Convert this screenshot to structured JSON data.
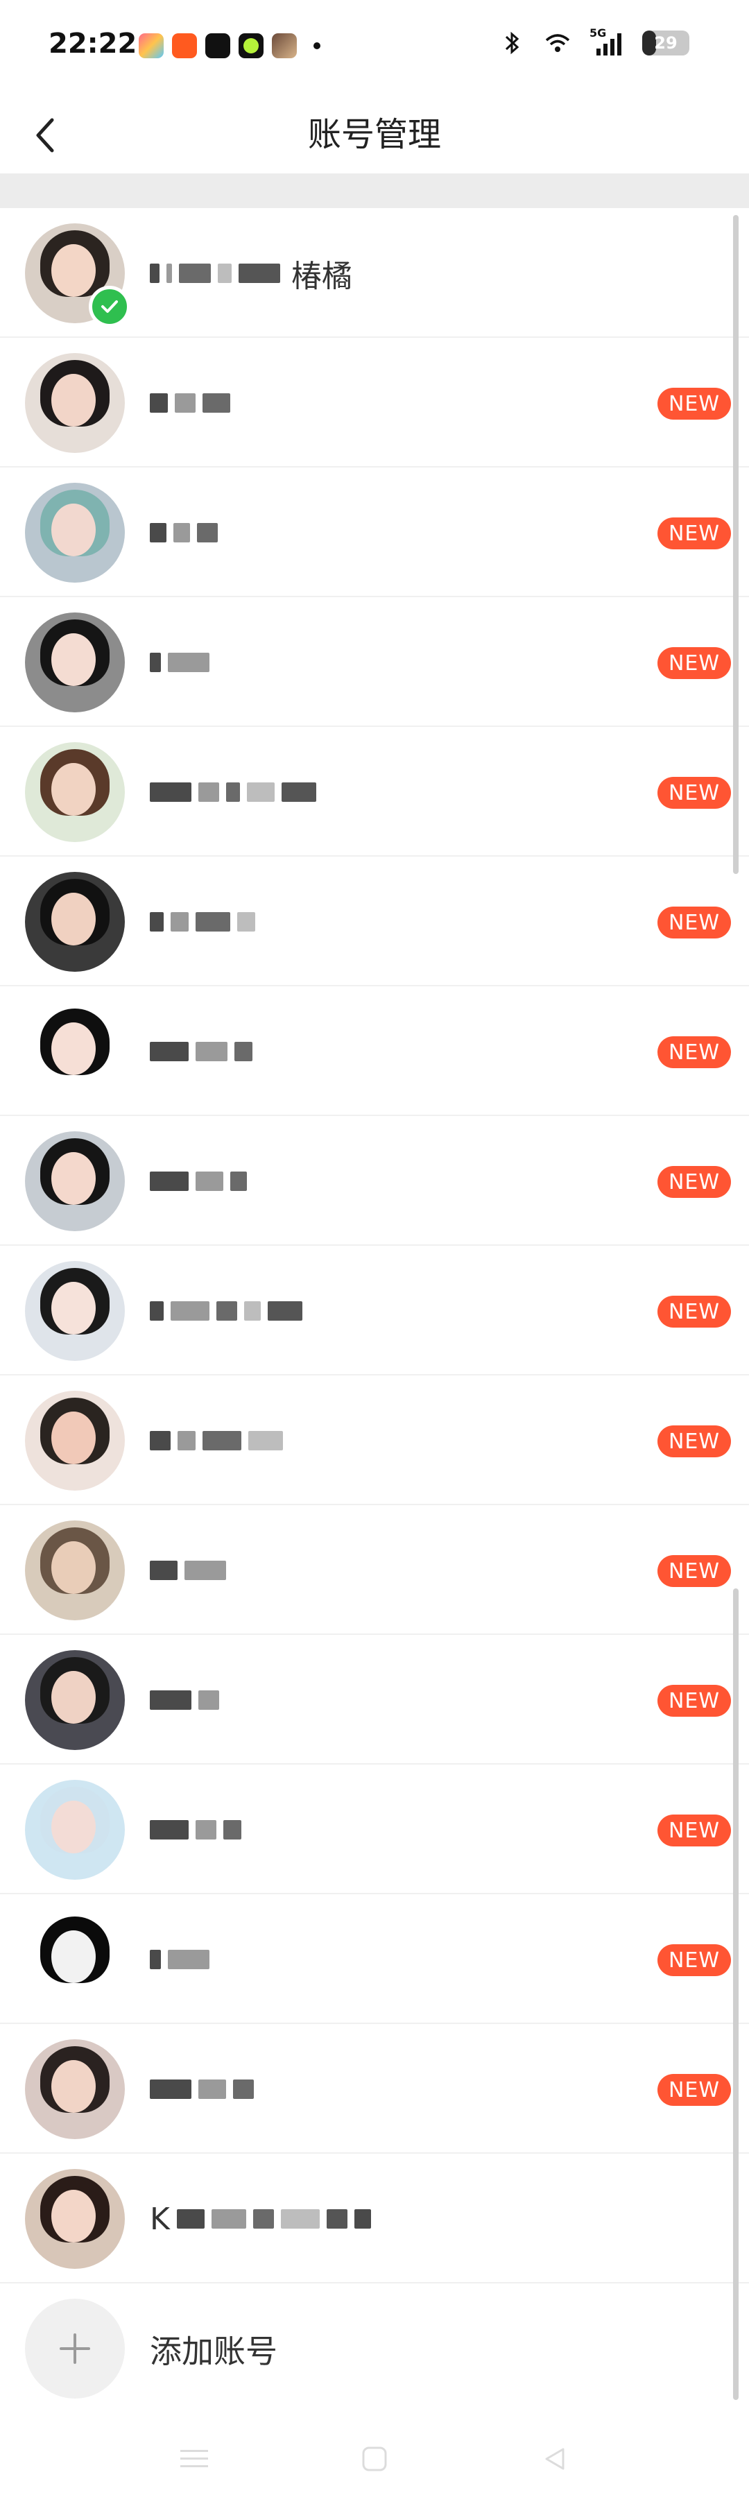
{
  "status_bar": {
    "time": "22:22",
    "battery": "29",
    "battery_level": 0.29,
    "network": "5G",
    "app_icons": [
      "gallery-app-icon",
      "taobao-app-icon",
      "face-app-icon",
      "green-app-icon",
      "photo-app-icon"
    ],
    "right_icons": [
      "bluetooth-icon",
      "wifi-icon",
      "cell-signal-icon",
      "battery-icon"
    ]
  },
  "header": {
    "title": "账号管理",
    "back_icon": "chevron-left-icon"
  },
  "accounts": [
    {
      "name_visible": "椿橘",
      "current": true,
      "badge": "",
      "hair": "#2b2420",
      "face": "#f3d6c6",
      "bg": "#d9cfc6",
      "blocks": [
        14,
        8,
        46,
        20,
        60
      ]
    },
    {
      "name_visible": "",
      "current": false,
      "badge": "NEW",
      "hair": "#1e1a1a",
      "face": "#f2d5c8",
      "bg": "#e6ded8",
      "blocks": [
        26,
        30,
        40
      ]
    },
    {
      "name_visible": "",
      "current": false,
      "badge": "NEW",
      "hair": "#7fb3b0",
      "face": "#f2d8cf",
      "bg": "#b9c6cf",
      "blocks": [
        24,
        24,
        30
      ]
    },
    {
      "name_visible": "",
      "current": false,
      "badge": "NEW",
      "hair": "#151515",
      "face": "#f4dcd2",
      "bg": "#8c8c8c",
      "blocks": [
        16,
        60
      ]
    },
    {
      "name_visible": "",
      "current": false,
      "badge": "NEW",
      "hair": "#5a3a2a",
      "face": "#f1d3c2",
      "bg": "#dfe9d8",
      "blocks": [
        60,
        30,
        20,
        40,
        50
      ]
    },
    {
      "name_visible": "",
      "current": false,
      "badge": "NEW",
      "hair": "#111111",
      "face": "#f0d1c1",
      "bg": "#3a3a3a",
      "blocks": [
        20,
        26,
        50,
        26
      ]
    },
    {
      "name_visible": "",
      "current": false,
      "badge": "NEW",
      "hair": "#0f0f0f",
      "face": "#f6dfd6",
      "bg": "#ffffff",
      "blocks": [
        56,
        46,
        26
      ]
    },
    {
      "name_visible": "",
      "current": false,
      "badge": "NEW",
      "hair": "#151515",
      "face": "#f4d8cc",
      "bg": "#c6ccd2",
      "blocks": [
        56,
        40,
        24
      ]
    },
    {
      "name_visible": "",
      "current": false,
      "badge": "NEW",
      "hair": "#1a1a1a",
      "face": "#f6e2da",
      "bg": "#dfe4ea",
      "blocks": [
        20,
        56,
        30,
        24,
        50
      ]
    },
    {
      "name_visible": "",
      "current": false,
      "badge": "NEW",
      "hair": "#2a2420",
      "face": "#f1c9b8",
      "bg": "#eee2dc",
      "blocks": [
        30,
        26,
        56,
        50
      ]
    },
    {
      "name_visible": "",
      "current": false,
      "badge": "NEW",
      "hair": "#6a5646",
      "face": "#e9cdb8",
      "bg": "#d8cbbb",
      "blocks": [
        40,
        60
      ]
    },
    {
      "name_visible": "",
      "current": false,
      "badge": "NEW",
      "hair": "#1a1a1a",
      "face": "#efd2c4",
      "bg": "#4a4a52",
      "blocks": [
        60,
        30
      ]
    },
    {
      "name_visible": "",
      "current": false,
      "badge": "NEW",
      "hair": "#cfe3ef",
      "face": "#f3dcd6",
      "bg": "#cfe6f2",
      "blocks": [
        56,
        30,
        26
      ]
    },
    {
      "name_visible": "",
      "current": false,
      "badge": "NEW",
      "hair": "#0b0b0b",
      "face": "#f2f2f2",
      "bg": "#ffffff",
      "blocks": [
        16,
        60
      ]
    },
    {
      "name_visible": "",
      "current": false,
      "badge": "NEW",
      "hair": "#2a2220",
      "face": "#f1d4c6",
      "bg": "#d9c9c4",
      "blocks": [
        60,
        40,
        30
      ]
    },
    {
      "name_visible": "K",
      "current": false,
      "badge": "",
      "hair": "#2a1c18",
      "face": "#f3d6c8",
      "bg": "#d8c6b8",
      "blocks": [
        40,
        50,
        30,
        56,
        30,
        24
      ]
    }
  ],
  "add_account": {
    "label": "添加账号",
    "icon": "plus-icon"
  },
  "nav_bar": {
    "icons": [
      "menu-icon",
      "home-icon",
      "back-triangle-icon"
    ]
  },
  "colors": {
    "badge": "#ff5533",
    "check": "#2fbf4f",
    "divider": "#ececec"
  }
}
